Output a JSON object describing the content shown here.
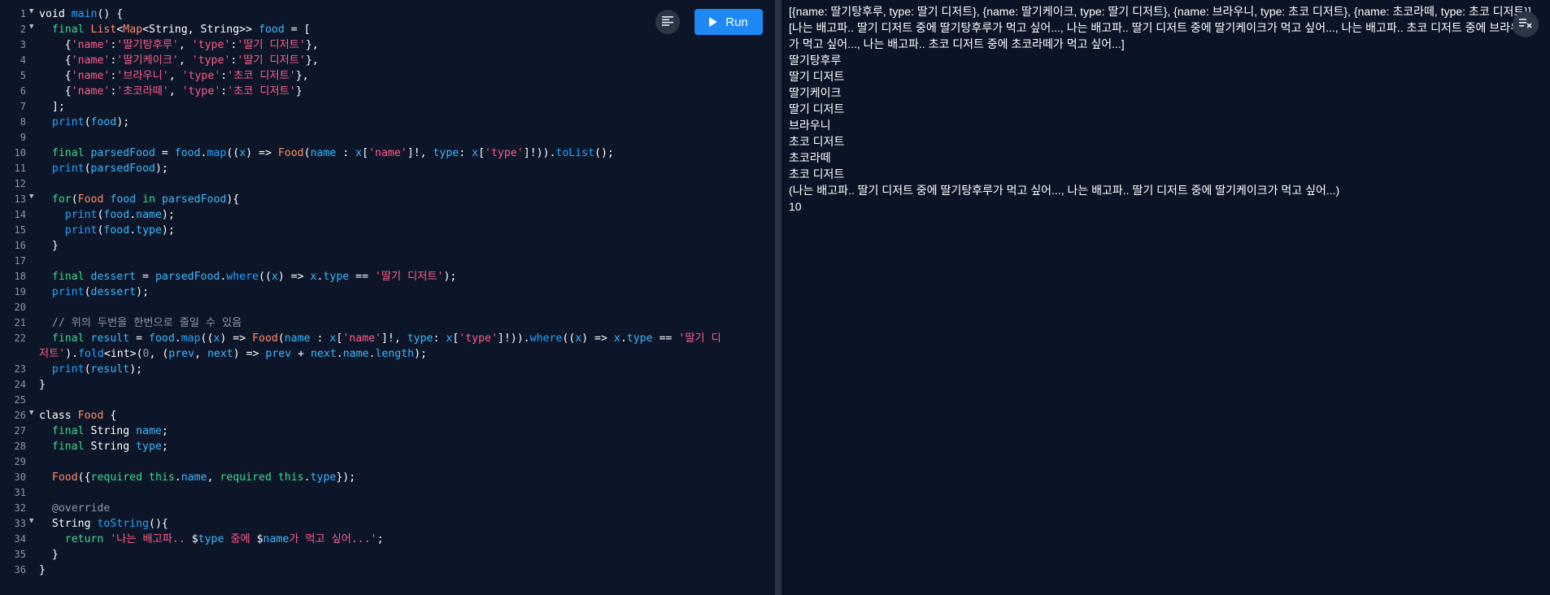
{
  "toolbar": {
    "run_label": "Run",
    "format_icon": "format-align-icon"
  },
  "console_toolbar": {
    "clear_icon": "clear-output-icon"
  },
  "code": [
    {
      "n": "1",
      "fold": true,
      "t": [
        [
          "kw",
          "void "
        ],
        [
          "fn",
          "main"
        ],
        [
          "pu",
          "() {"
        ]
      ]
    },
    {
      "n": "2",
      "fold": true,
      "t": [
        [
          "pu",
          "  "
        ],
        [
          "kw2",
          "final "
        ],
        [
          "ty",
          "List"
        ],
        [
          "pu",
          "<"
        ],
        [
          "ty",
          "Map"
        ],
        [
          "pu",
          "<String, String>> "
        ],
        [
          "id",
          "food"
        ],
        [
          "pu",
          " = ["
        ]
      ]
    },
    {
      "n": "3",
      "t": [
        [
          "pu",
          "    {"
        ],
        [
          "str",
          "'name'"
        ],
        [
          "pu",
          ":"
        ],
        [
          "str",
          "'딸기탕후루'"
        ],
        [
          "pu",
          ", "
        ],
        [
          "str",
          "'type'"
        ],
        [
          "pu",
          ":"
        ],
        [
          "str",
          "'딸기 디저트'"
        ],
        [
          "pu",
          "},"
        ]
      ]
    },
    {
      "n": "4",
      "t": [
        [
          "pu",
          "    {"
        ],
        [
          "str",
          "'name'"
        ],
        [
          "pu",
          ":"
        ],
        [
          "str",
          "'딸기케이크'"
        ],
        [
          "pu",
          ", "
        ],
        [
          "str",
          "'type'"
        ],
        [
          "pu",
          ":"
        ],
        [
          "str",
          "'딸기 디저트'"
        ],
        [
          "pu",
          "},"
        ]
      ]
    },
    {
      "n": "5",
      "t": [
        [
          "pu",
          "    {"
        ],
        [
          "str",
          "'name'"
        ],
        [
          "pu",
          ":"
        ],
        [
          "str",
          "'브라우니'"
        ],
        [
          "pu",
          ", "
        ],
        [
          "str",
          "'type'"
        ],
        [
          "pu",
          ":"
        ],
        [
          "str",
          "'초코 디저트'"
        ],
        [
          "pu",
          "},"
        ]
      ]
    },
    {
      "n": "6",
      "t": [
        [
          "pu",
          "    {"
        ],
        [
          "str",
          "'name'"
        ],
        [
          "pu",
          ":"
        ],
        [
          "str",
          "'초코라떼'"
        ],
        [
          "pu",
          ", "
        ],
        [
          "str",
          "'type'"
        ],
        [
          "pu",
          ":"
        ],
        [
          "str",
          "'초코 디저트'"
        ],
        [
          "pu",
          "}"
        ]
      ]
    },
    {
      "n": "7",
      "t": [
        [
          "pu",
          "  ];"
        ]
      ]
    },
    {
      "n": "8",
      "t": [
        [
          "pu",
          "  "
        ],
        [
          "fn",
          "print"
        ],
        [
          "pu",
          "("
        ],
        [
          "id",
          "food"
        ],
        [
          "pu",
          ");"
        ]
      ]
    },
    {
      "n": "9",
      "t": []
    },
    {
      "n": "10",
      "t": [
        [
          "pu",
          "  "
        ],
        [
          "kw2",
          "final "
        ],
        [
          "id",
          "parsedFood"
        ],
        [
          "pu",
          " = "
        ],
        [
          "id",
          "food"
        ],
        [
          "pu",
          "."
        ],
        [
          "fn",
          "map"
        ],
        [
          "pu",
          "(("
        ],
        [
          "id",
          "x"
        ],
        [
          "pu",
          ") => "
        ],
        [
          "ty",
          "Food"
        ],
        [
          "pu",
          "("
        ],
        [
          "id",
          "name"
        ],
        [
          "pu",
          " : "
        ],
        [
          "id",
          "x"
        ],
        [
          "pu",
          "["
        ],
        [
          "str",
          "'name'"
        ],
        [
          "pu",
          "]!, "
        ],
        [
          "id",
          "type"
        ],
        [
          "pu",
          ": "
        ],
        [
          "id",
          "x"
        ],
        [
          "pu",
          "["
        ],
        [
          "str",
          "'type'"
        ],
        [
          "pu",
          "]!))."
        ],
        [
          "fn",
          "toList"
        ],
        [
          "pu",
          "();"
        ]
      ]
    },
    {
      "n": "11",
      "t": [
        [
          "pu",
          "  "
        ],
        [
          "fn",
          "print"
        ],
        [
          "pu",
          "("
        ],
        [
          "id",
          "parsedFood"
        ],
        [
          "pu",
          ");"
        ]
      ]
    },
    {
      "n": "12",
      "t": []
    },
    {
      "n": "13",
      "fold": true,
      "t": [
        [
          "pu",
          "  "
        ],
        [
          "kw2",
          "for"
        ],
        [
          "pu",
          "("
        ],
        [
          "ty",
          "Food"
        ],
        [
          "pu",
          " "
        ],
        [
          "id",
          "food"
        ],
        [
          "pu",
          " "
        ],
        [
          "kw2",
          "in"
        ],
        [
          "pu",
          " "
        ],
        [
          "id",
          "parsedFood"
        ],
        [
          "pu",
          "){"
        ]
      ]
    },
    {
      "n": "14",
      "t": [
        [
          "pu",
          "    "
        ],
        [
          "fn",
          "print"
        ],
        [
          "pu",
          "("
        ],
        [
          "id",
          "food"
        ],
        [
          "pu",
          "."
        ],
        [
          "id",
          "name"
        ],
        [
          "pu",
          ");"
        ]
      ]
    },
    {
      "n": "15",
      "t": [
        [
          "pu",
          "    "
        ],
        [
          "fn",
          "print"
        ],
        [
          "pu",
          "("
        ],
        [
          "id",
          "food"
        ],
        [
          "pu",
          "."
        ],
        [
          "id",
          "type"
        ],
        [
          "pu",
          ");"
        ]
      ]
    },
    {
      "n": "16",
      "t": [
        [
          "pu",
          "  }"
        ]
      ]
    },
    {
      "n": "17",
      "t": []
    },
    {
      "n": "18",
      "t": [
        [
          "pu",
          "  "
        ],
        [
          "kw2",
          "final "
        ],
        [
          "id",
          "dessert"
        ],
        [
          "pu",
          " = "
        ],
        [
          "id",
          "parsedFood"
        ],
        [
          "pu",
          "."
        ],
        [
          "fn",
          "where"
        ],
        [
          "pu",
          "(("
        ],
        [
          "id",
          "x"
        ],
        [
          "pu",
          ") => "
        ],
        [
          "id",
          "x"
        ],
        [
          "pu",
          "."
        ],
        [
          "id",
          "type"
        ],
        [
          "pu",
          " == "
        ],
        [
          "str",
          "'딸기 디저트'"
        ],
        [
          "pu",
          ");"
        ]
      ]
    },
    {
      "n": "19",
      "t": [
        [
          "pu",
          "  "
        ],
        [
          "fn",
          "print"
        ],
        [
          "pu",
          "("
        ],
        [
          "id",
          "dessert"
        ],
        [
          "pu",
          ");"
        ]
      ]
    },
    {
      "n": "20",
      "t": []
    },
    {
      "n": "21",
      "t": [
        [
          "cm",
          "  // 위의 두번을 한번으로 줄일 수 있음"
        ]
      ]
    },
    {
      "n": "22",
      "t": [
        [
          "pu",
          "  "
        ],
        [
          "kw2",
          "final "
        ],
        [
          "id",
          "result"
        ],
        [
          "pu",
          " = "
        ],
        [
          "id",
          "food"
        ],
        [
          "pu",
          "."
        ],
        [
          "fn",
          "map"
        ],
        [
          "pu",
          "(("
        ],
        [
          "id",
          "x"
        ],
        [
          "pu",
          ") => "
        ],
        [
          "ty",
          "Food"
        ],
        [
          "pu",
          "("
        ],
        [
          "id",
          "name"
        ],
        [
          "pu",
          " : "
        ],
        [
          "id",
          "x"
        ],
        [
          "pu",
          "["
        ],
        [
          "str",
          "'name'"
        ],
        [
          "pu",
          "]!, "
        ],
        [
          "id",
          "type"
        ],
        [
          "pu",
          ": "
        ],
        [
          "id",
          "x"
        ],
        [
          "pu",
          "["
        ],
        [
          "str",
          "'type'"
        ],
        [
          "pu",
          "]!))."
        ],
        [
          "fn",
          "where"
        ],
        [
          "pu",
          "(("
        ],
        [
          "id",
          "x"
        ],
        [
          "pu",
          ") => "
        ],
        [
          "id",
          "x"
        ],
        [
          "pu",
          "."
        ],
        [
          "id",
          "type"
        ],
        [
          "pu",
          " == "
        ],
        [
          "str",
          "'딸기 디"
        ]
      ]
    },
    {
      "n": "",
      "t": [
        [
          "str",
          "저트'"
        ],
        [
          "pu",
          ")."
        ],
        [
          "fn",
          "fold"
        ],
        [
          "pu",
          "<int>("
        ],
        [
          "cm",
          "0"
        ],
        [
          "pu",
          ", ("
        ],
        [
          "id",
          "prev"
        ],
        [
          "pu",
          ", "
        ],
        [
          "id",
          "next"
        ],
        [
          "pu",
          ") => "
        ],
        [
          "id",
          "prev"
        ],
        [
          "pu",
          " + "
        ],
        [
          "id",
          "next"
        ],
        [
          "pu",
          "."
        ],
        [
          "id",
          "name"
        ],
        [
          "pu",
          "."
        ],
        [
          "id",
          "length"
        ],
        [
          "pu",
          ");"
        ]
      ],
      "wrap": true
    },
    {
      "n": "23",
      "t": [
        [
          "pu",
          "  "
        ],
        [
          "fn",
          "print"
        ],
        [
          "pu",
          "("
        ],
        [
          "id",
          "result"
        ],
        [
          "pu",
          ");"
        ]
      ]
    },
    {
      "n": "24",
      "t": [
        [
          "pu",
          "}"
        ]
      ]
    },
    {
      "n": "25",
      "t": []
    },
    {
      "n": "26",
      "fold": true,
      "t": [
        [
          "kw",
          "class "
        ],
        [
          "ty",
          "Food"
        ],
        [
          "pu",
          " {"
        ]
      ]
    },
    {
      "n": "27",
      "t": [
        [
          "pu",
          "  "
        ],
        [
          "kw2",
          "final "
        ],
        [
          "kw",
          "String "
        ],
        [
          "id",
          "name"
        ],
        [
          "pu",
          ";"
        ]
      ]
    },
    {
      "n": "28",
      "t": [
        [
          "pu",
          "  "
        ],
        [
          "kw2",
          "final "
        ],
        [
          "kw",
          "String "
        ],
        [
          "id",
          "type"
        ],
        [
          "pu",
          ";"
        ]
      ]
    },
    {
      "n": "29",
      "t": []
    },
    {
      "n": "30",
      "t": [
        [
          "pu",
          "  "
        ],
        [
          "ty",
          "Food"
        ],
        [
          "pu",
          "({"
        ],
        [
          "kw2",
          "required "
        ],
        [
          "kw2",
          "this"
        ],
        [
          "pu",
          "."
        ],
        [
          "id",
          "name"
        ],
        [
          "pu",
          ", "
        ],
        [
          "kw2",
          "required "
        ],
        [
          "kw2",
          "this"
        ],
        [
          "pu",
          "."
        ],
        [
          "id",
          "type"
        ],
        [
          "pu",
          "});"
        ]
      ]
    },
    {
      "n": "31",
      "t": []
    },
    {
      "n": "32",
      "t": [
        [
          "cm",
          "  @override"
        ]
      ]
    },
    {
      "n": "33",
      "fold": true,
      "t": [
        [
          "pu",
          "  "
        ],
        [
          "kw",
          "String "
        ],
        [
          "fn",
          "toString"
        ],
        [
          "pu",
          "(){"
        ]
      ]
    },
    {
      "n": "34",
      "t": [
        [
          "pu",
          "    "
        ],
        [
          "kw2",
          "return "
        ],
        [
          "str",
          "'나는 배고파.. "
        ],
        [
          "pu",
          "$"
        ],
        [
          "id",
          "type"
        ],
        [
          "str",
          " 중에 "
        ],
        [
          "pu",
          "$"
        ],
        [
          "id",
          "name"
        ],
        [
          "str",
          "가 먹고 싶어...'"
        ],
        [
          "pu",
          ";"
        ]
      ]
    },
    {
      "n": "35",
      "t": [
        [
          "pu",
          "  }"
        ]
      ]
    },
    {
      "n": "36",
      "t": [
        [
          "pu",
          "}"
        ]
      ]
    }
  ],
  "output": [
    "[{name: 딸기탕후루, type: 딸기 디저트}, {name: 딸기케이크, type: 딸기 디저트}, {name: 브라우니, type: 초코 디저트}, {name: 초코라떼, type: 초코 디저트}]",
    "[나는 배고파.. 딸기 디저트 중에 딸기탕후루가 먹고 싶어..., 나는 배고파.. 딸기 디저트 중에 딸기케이크가 먹고 싶어..., 나는 배고파.. 초코 디저트 중에 브라우니가 먹고 싶어..., 나는 배고파.. 초코 디저트 중에 초코라떼가 먹고 싶어...]",
    "딸기탕후루",
    "딸기 디저트",
    "딸기케이크",
    "딸기 디저트",
    "브라우니",
    "초코 디저트",
    "초코라떼",
    "초코 디저트",
    "(나는 배고파.. 딸기 디저트 중에 딸기탕후루가 먹고 싶어..., 나는 배고파.. 딸기 디저트 중에 딸기케이크가 먹고 싶어...)",
    "10"
  ]
}
